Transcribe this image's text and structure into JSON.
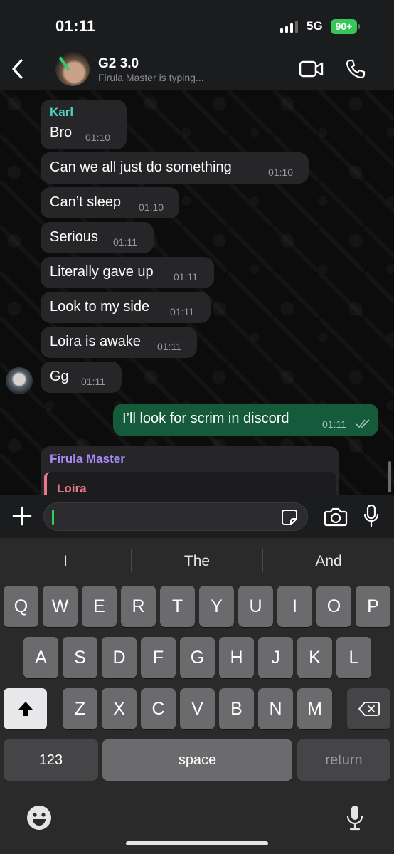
{
  "status_bar": {
    "time": "01:11",
    "network": "5G",
    "battery": "90+"
  },
  "chat_header": {
    "title": "G2 3.0",
    "subtitle": "Firula Master is typing..."
  },
  "messages": [
    {
      "sender": "Karl",
      "text": "Bro",
      "time": "01:10",
      "direction": "in"
    },
    {
      "text": "Can we all just do something",
      "time": "01:10",
      "direction": "in"
    },
    {
      "text": "Can’t sleep",
      "time": "01:10",
      "direction": "in"
    },
    {
      "text": "Serious",
      "time": "01:11",
      "direction": "in"
    },
    {
      "text": "Literally gave up",
      "time": "01:11",
      "direction": "in"
    },
    {
      "text": "Look to my side",
      "time": "01:11",
      "direction": "in"
    },
    {
      "text": "Loira is awake",
      "time": "01:11",
      "direction": "in"
    },
    {
      "text": "Gg",
      "time": "01:11",
      "direction": "in"
    },
    {
      "text": "I’ll look for scrim in discord",
      "time": "01:11",
      "direction": "out",
      "status": "read"
    }
  ],
  "reply_preview": {
    "sender": "Firula Master",
    "quoted_sender": "Loira"
  },
  "composer": {
    "value": ""
  },
  "keyboard": {
    "suggestions": [
      "I",
      "The",
      "And"
    ],
    "row1": [
      "Q",
      "W",
      "E",
      "R",
      "T",
      "Y",
      "U",
      "I",
      "O",
      "P"
    ],
    "row2": [
      "A",
      "S",
      "D",
      "F",
      "G",
      "H",
      "J",
      "K",
      "L"
    ],
    "row3": [
      "Z",
      "X",
      "C",
      "V",
      "B",
      "N",
      "M"
    ],
    "numbers_label": "123",
    "space_label": "space",
    "return_label": "return"
  },
  "colors": {
    "karl_name": "#4fd1c5",
    "firula_name": "#a78bfa",
    "loira_name": "#e57b8a",
    "outgoing_bubble": "#155a3a",
    "incoming_bubble": "#262628",
    "battery": "#34c759"
  },
  "icons": {
    "back": "chevron-left-icon",
    "video": "video-camera-icon",
    "call": "phone-icon",
    "attach": "plus-icon",
    "sticker": "sticker-icon",
    "camera": "camera-icon",
    "mic": "microphone-icon",
    "shift": "shift-arrow-icon",
    "delete": "backspace-icon",
    "emoji": "emoji-icon",
    "dictation": "microphone-icon"
  }
}
